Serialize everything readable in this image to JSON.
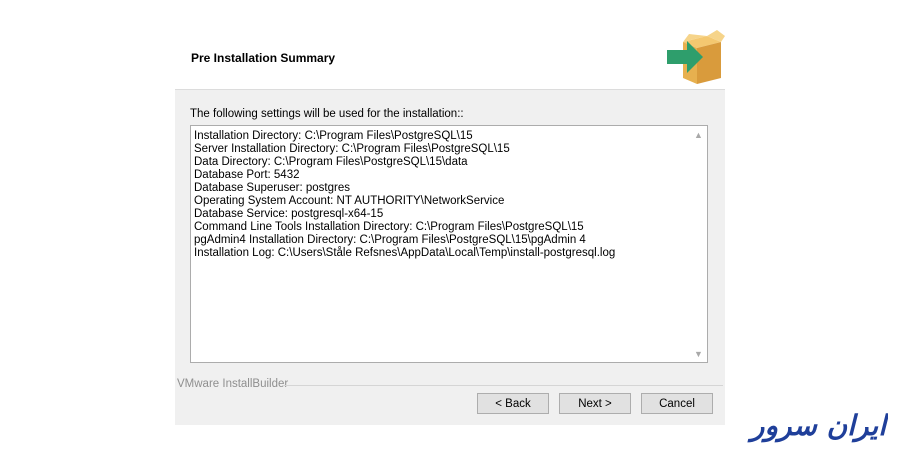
{
  "header": {
    "title": "Pre Installation Summary",
    "icon": "installer-box-arrow-icon"
  },
  "intro_text": "The following settings will be used for the installation::",
  "summary_lines": [
    "Installation Directory: C:\\Program Files\\PostgreSQL\\15",
    "Server Installation Directory: C:\\Program Files\\PostgreSQL\\15",
    "Data Directory: C:\\Program Files\\PostgreSQL\\15\\data",
    "Database Port: 5432",
    "Database Superuser: postgres",
    "Operating System Account: NT AUTHORITY\\NetworkService",
    "Database Service: postgresql-x64-15",
    "Command Line Tools Installation Directory: C:\\Program Files\\PostgreSQL\\15",
    "pgAdmin4 Installation Directory: C:\\Program Files\\PostgreSQL\\15\\pgAdmin 4",
    "Installation Log: C:\\Users\\Ståle Refsnes\\AppData\\Local\\Temp\\install-postgresql.log"
  ],
  "footer": {
    "brand": "VMware InstallBuilder",
    "back_label": "< Back",
    "next_label": "Next >",
    "cancel_label": "Cancel"
  },
  "watermark": {
    "text": "ایران سرور",
    "color": "#1f3f9a"
  },
  "colors": {
    "icon_green": "#2e9e6c",
    "icon_box": "#e7b04f"
  }
}
